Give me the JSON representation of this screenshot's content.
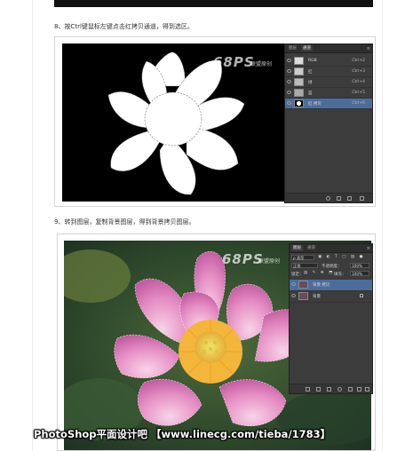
{
  "step8": {
    "text": "8、按Ctrl键鼠标左键点击红拷贝通道，得到选区。"
  },
  "step9": {
    "text": "9、转到图层，复制背景图层，得到背景拷贝图层。"
  },
  "watermark": {
    "logo": "68PS",
    "sub": "联盟原创"
  },
  "channels_panel": {
    "tabs": [
      "图层",
      "通道"
    ],
    "active_tab": 1,
    "rows": [
      {
        "name": "RGB",
        "shortcut": "Ctrl+2",
        "visible": true,
        "selected": false
      },
      {
        "name": "红",
        "shortcut": "Ctrl+3",
        "visible": true,
        "selected": false
      },
      {
        "name": "绿",
        "shortcut": "Ctrl+4",
        "visible": true,
        "selected": false
      },
      {
        "name": "蓝",
        "shortcut": "Ctrl+5",
        "visible": true,
        "selected": false
      },
      {
        "name": "红 拷贝",
        "shortcut": "Ctrl+6",
        "visible": true,
        "selected": true
      }
    ]
  },
  "layers_panel": {
    "tabs": [
      "图层",
      "通道"
    ],
    "active_tab": 0,
    "kind_label": "ρ 类型",
    "blend_mode": "正常",
    "opacity_label": "不透明度：",
    "opacity_value": "100%",
    "lock_label": "锁定：",
    "fill_label": "填充：",
    "fill_value": "100%",
    "layers": [
      {
        "name": "背景 拷贝",
        "visible": true,
        "selected": true
      },
      {
        "name": "背景",
        "visible": true,
        "selected": false,
        "locked": true
      }
    ]
  },
  "footer_watermark": "PhotoShop平面设计吧 【www.linecg.com/tieba/1783】",
  "colors": {
    "panel_bg": "#3c3c3c",
    "selection_blue": "#4c6d9c",
    "canvas_black": "#000000"
  }
}
